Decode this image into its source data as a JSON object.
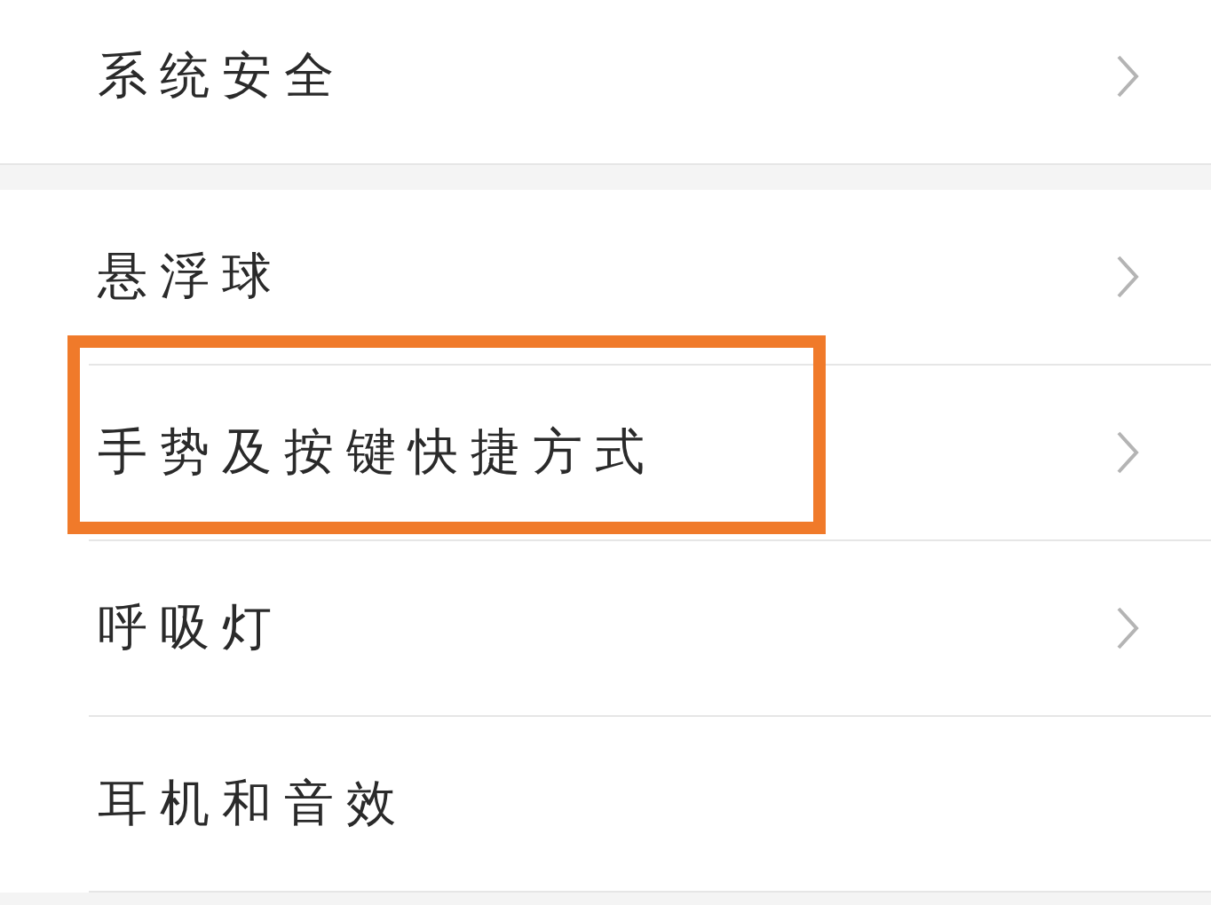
{
  "groups": [
    {
      "items": [
        {
          "label": "系统安全",
          "chevron": true,
          "highlighted": false
        }
      ]
    },
    {
      "items": [
        {
          "label": "悬浮球",
          "chevron": true,
          "highlighted": false
        },
        {
          "label": "手势及按键快捷方式",
          "chevron": true,
          "highlighted": true
        },
        {
          "label": "呼吸灯",
          "chevron": true,
          "highlighted": false
        },
        {
          "label": "耳机和音效",
          "chevron": false,
          "highlighted": false
        }
      ]
    }
  ]
}
